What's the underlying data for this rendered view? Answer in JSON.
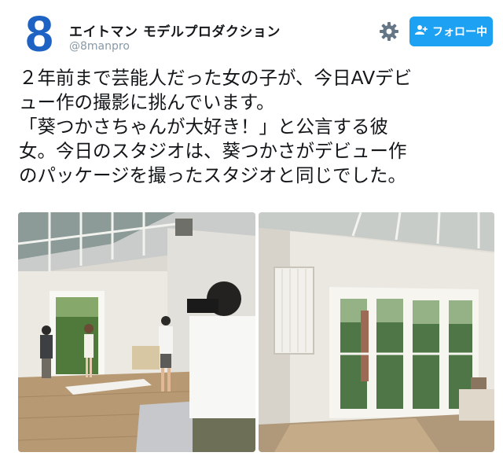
{
  "account": {
    "avatar_glyph": "8",
    "display_name": "エイトマン モデルプロダクション",
    "handle": "@8manpro",
    "brand_color": "#1e63c4"
  },
  "actions": {
    "settings_icon": "gear-icon",
    "follow_icon": "person-plus-icon",
    "follow_label": "フォロー中",
    "accent_color": "#1da1f2"
  },
  "tweet": {
    "lines": [
      "２年前まで芸能人だった女の子が、今日AVデビ",
      "ュー作の撮影に挑んでいます。",
      "「葵つかさちゃんが大好き！」と公言する彼",
      "女。今日のスタジオは、葵つかさがデビュー作",
      "のパッケージを撮ったスタジオと同じでした。"
    ]
  },
  "media": {
    "count": 2,
    "photos": [
      "photo-studio-shoot",
      "photo-studio-interior"
    ]
  }
}
